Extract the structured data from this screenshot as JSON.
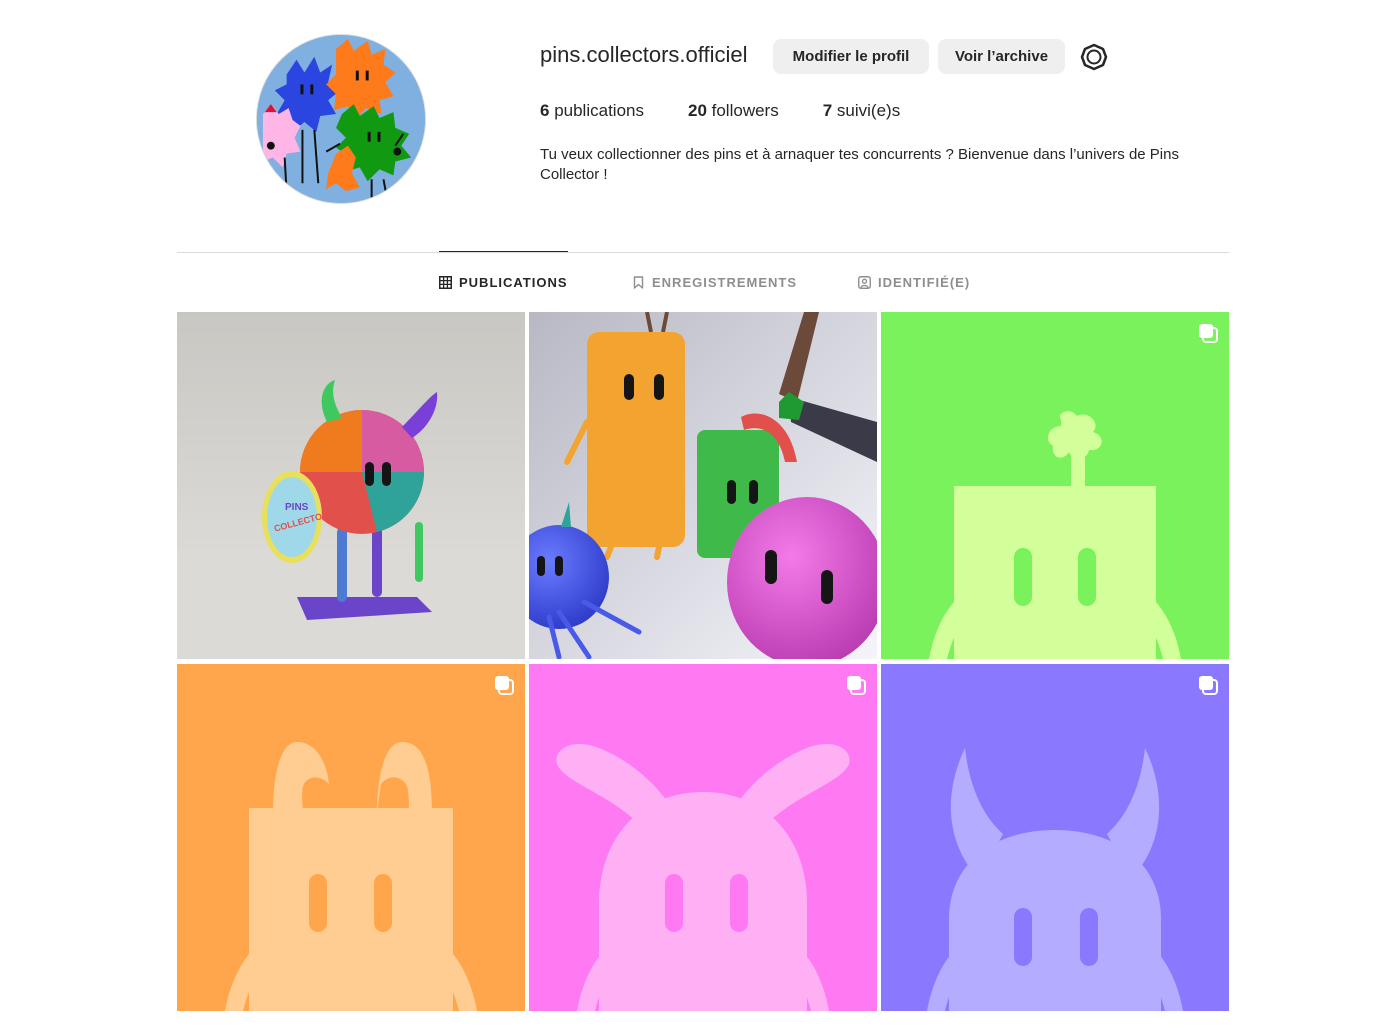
{
  "profile": {
    "username": "pins.collectors.officiel",
    "edit_label": "Modifier le profil",
    "archive_label": "Voir l’archive",
    "settings_icon": "gear-icon",
    "stats": {
      "posts_count": "6",
      "posts_label": " publications",
      "followers_count": "20",
      "followers_label": " followers",
      "following_count": "7",
      "following_label": " suivi(e)s"
    },
    "bio": "Tu veux collectionner des pins et à arnaquer tes concurrents ? Bienvenue dans l’univers de Pins Collector !"
  },
  "tabs": [
    {
      "label": "PUBLICATIONS",
      "icon": "grid-icon",
      "active": true
    },
    {
      "label": "ENREGISTREMENTS",
      "icon": "bookmark-icon",
      "active": false
    },
    {
      "label": "IDENTIFIÉ(E)",
      "icon": "tagged-user-icon",
      "active": false
    }
  ],
  "posts": [
    {
      "kind": "photo",
      "multi": false,
      "badge_text": "PINS COLLECTOR"
    },
    {
      "kind": "render",
      "multi": false
    },
    {
      "kind": "silhouette",
      "multi": true,
      "bg": "#79f25b",
      "fg": "#d2ff9a"
    },
    {
      "kind": "silhouette",
      "multi": true,
      "bg": "#ffa64d",
      "fg": "#ffcd91"
    },
    {
      "kind": "silhouette",
      "multi": true,
      "bg": "#ff7af2",
      "fg": "#ffb0f5"
    },
    {
      "kind": "silhouette",
      "multi": true,
      "bg": "#8a79ff",
      "fg": "#b3acff"
    }
  ],
  "colors": {
    "text": "#262626",
    "muted": "#8e8e8e",
    "button_bg": "#efefef",
    "divider": "#dbdbdb"
  }
}
